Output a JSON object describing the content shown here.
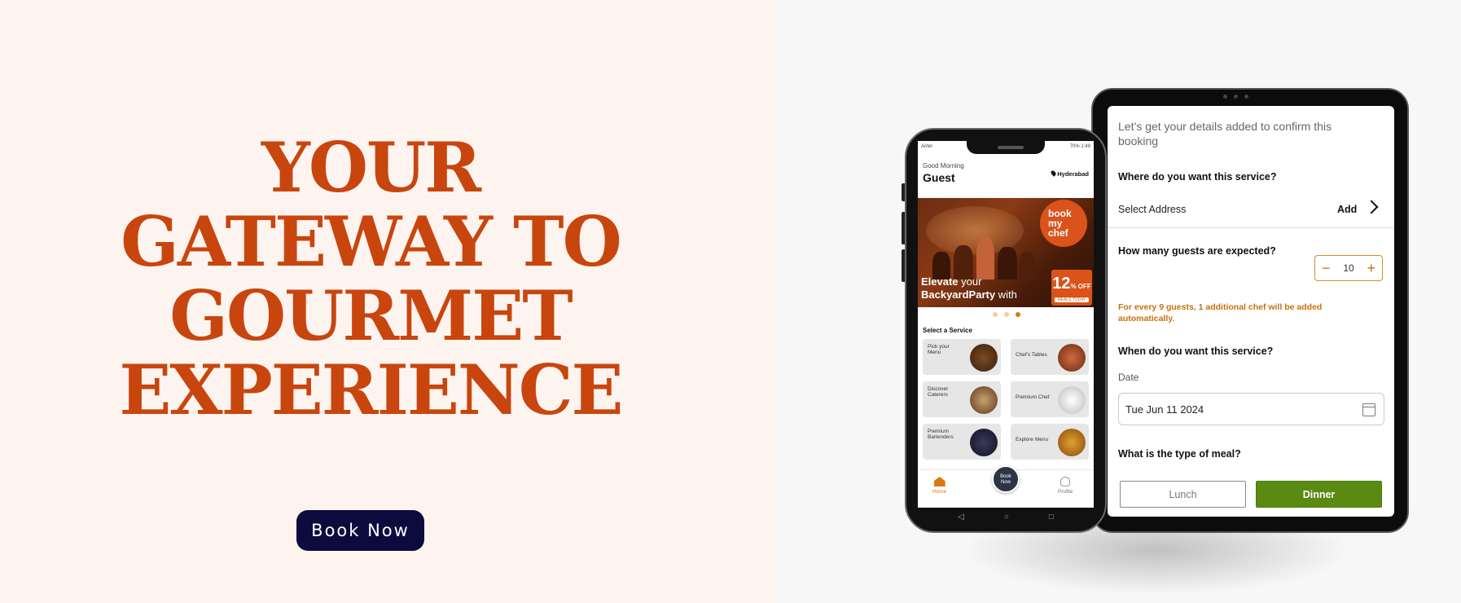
{
  "hero": {
    "title_lines": [
      "YOUR",
      "GATEWAY TO",
      "GOURMET",
      "EXPERIENCE"
    ],
    "cta_label": "Book Now"
  },
  "colors": {
    "accent": "#c8460e",
    "cta_bg": "#0d0b3d",
    "left_bg": "#fdf4f0",
    "right_bg": "#f7f7f7",
    "dinner_green": "#5a8a12",
    "note_orange": "#c87010"
  },
  "phone": {
    "status_left": "Airtel",
    "status_right": "70% 1:49",
    "greeting": "Good Morning",
    "user": "Guest",
    "location": "Hyderabad",
    "banner": {
      "logo_lines": [
        "book",
        "my",
        "chef"
      ],
      "headline_1a": "Elevate",
      "headline_1b": " your",
      "headline_2a": "BackyardParty",
      "headline_2b": " with",
      "offer_value": "12",
      "offer_suffix": "% OFF",
      "offer_sub": "MEALS TODAY"
    },
    "carousel_active_index": 2,
    "section_title": "Select a Service",
    "services": [
      {
        "label_1": "Pick your",
        "label_2": "Menu"
      },
      {
        "label_1": "Chef's Tables",
        "label_2": ""
      },
      {
        "label_1": "Discover",
        "label_2": "Caterers"
      },
      {
        "label_1": "Premium Chef",
        "label_2": ""
      },
      {
        "label_1": "Premium",
        "label_2": "Bartenders"
      },
      {
        "label_1": "Explore Menu",
        "label_2": ""
      }
    ],
    "nav": {
      "home": "Home",
      "book_1": "Book",
      "book_2": "Now",
      "profile": "Profile"
    }
  },
  "tablet": {
    "intro": "Let’s get your details added to confirm this booking",
    "q_service_where": "Where do you want this service?",
    "address_label": "Select Address",
    "address_action": "Add",
    "q_guests": "How many guests are expected?",
    "guests_value": "10",
    "minus": "−",
    "plus": "+",
    "guest_note": "For every 9 guests, 1 additional chef will be added automatically.",
    "q_when": "When do you want this service?",
    "date_label": "Date",
    "date_value": "Tue Jun 11 2024",
    "q_meal": "What is the type of meal?",
    "meal_lunch": "Lunch",
    "meal_dinner": "Dinner",
    "selected_meal": "Dinner"
  }
}
